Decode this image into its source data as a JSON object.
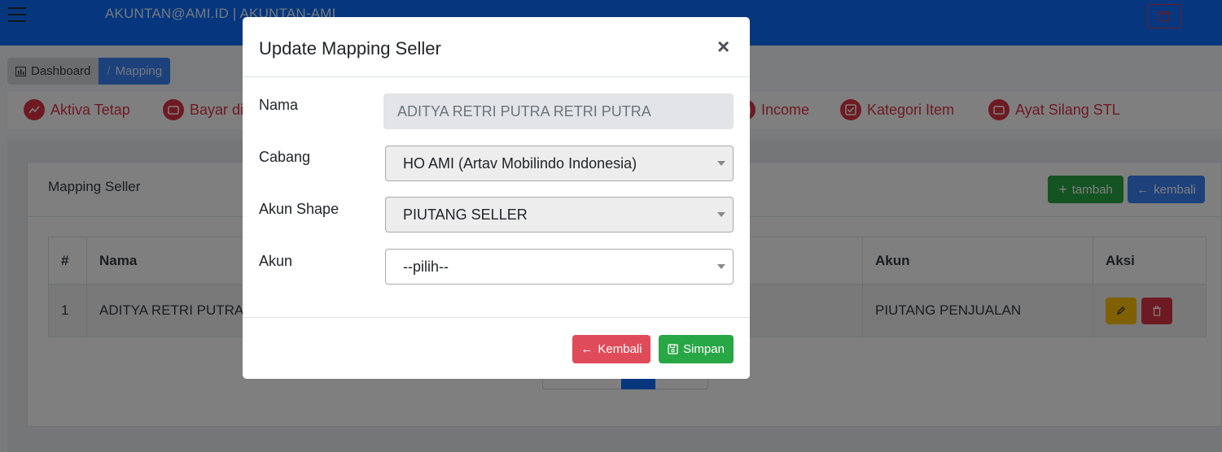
{
  "topbar": {
    "title": "AKUNTAN@AMI.ID | AKUNTAN-AMI"
  },
  "breadcrumb": {
    "dashboard": "Dashboard",
    "mapping": "Mapping"
  },
  "menu": [
    {
      "label": "Aktiva Tetap",
      "icon": "chart-icon"
    },
    {
      "label": "Bayar di",
      "icon": "wallet-icon"
    },
    {
      "label": "Income",
      "icon": "wallet-icon"
    },
    {
      "label": "Kategori Item",
      "icon": "checkbox-icon"
    },
    {
      "label": "Ayat Silang STL",
      "icon": "wallet-icon"
    }
  ],
  "card": {
    "title": "Mapping Seller",
    "tambah_label": "tambah",
    "kembali_label": "kembali"
  },
  "table": {
    "headers": {
      "no": "#",
      "nama": "Nama",
      "akun": "Akun",
      "aksi": "Aksi"
    },
    "rows": [
      {
        "no": "1",
        "nama": "ADITYA RETRI PUTRA",
        "akun": "PIUTANG PENJUALAN"
      }
    ]
  },
  "modal": {
    "title": "Update Mapping Seller",
    "close": "×",
    "fields": {
      "nama_label": "Nama",
      "nama_value": "ADITYA RETRI PUTRA RETRI PUTRA",
      "cabang_label": "Cabang",
      "cabang_value": "HO AMI (Artav Mobilindo Indonesia)",
      "akun_shape_label": "Akun Shape",
      "akun_shape_value": "PIUTANG SELLER",
      "akun_label": "Akun",
      "akun_value": "--pilih--"
    },
    "kembali_label": "Kembali",
    "simpan_label": "Simpan"
  },
  "colors": {
    "primary": "#0d6efd",
    "danger": "#dc3545",
    "success": "#28a745",
    "warning": "#ffc107"
  }
}
